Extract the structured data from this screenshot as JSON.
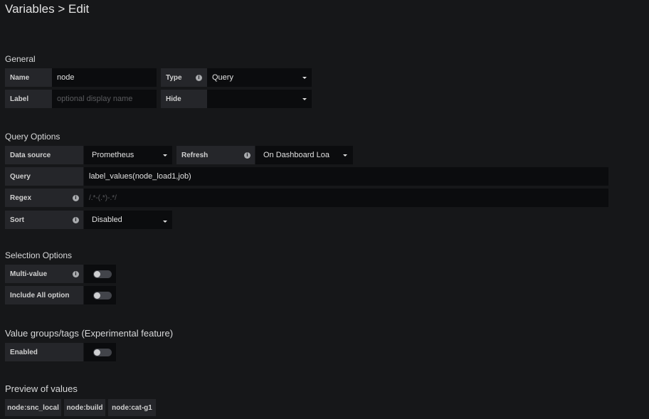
{
  "header": {
    "title": "Variables > Edit"
  },
  "general": {
    "section_title": "General",
    "name_label": "Name",
    "name_value": "node",
    "type_label": "Type",
    "type_value": "Query",
    "label_label": "Label",
    "label_placeholder": "optional display name",
    "hide_label": "Hide",
    "hide_value": ""
  },
  "query_options": {
    "section_title": "Query Options",
    "datasource_label": "Data source",
    "datasource_value": "Prometheus",
    "refresh_label": "Refresh",
    "refresh_value": "On Dashboard Loa",
    "query_label": "Query",
    "query_value": "label_values(node_load1,job)",
    "regex_label": "Regex",
    "regex_placeholder": "/.*-(.*)-.*/",
    "sort_label": "Sort",
    "sort_value": "Disabled"
  },
  "selection_options": {
    "section_title": "Selection Options",
    "multi_value_label": "Multi-value",
    "multi_value_enabled": false,
    "include_all_label": "Include All option",
    "include_all_enabled": false
  },
  "value_groups": {
    "section_title": "Value groups/tags (Experimental feature)",
    "enabled_label": "Enabled",
    "enabled": false
  },
  "preview": {
    "section_title": "Preview of values",
    "values": [
      "node:snc_local",
      "node:build",
      "node:cat-g1"
    ]
  },
  "icons": {
    "info": "i"
  }
}
